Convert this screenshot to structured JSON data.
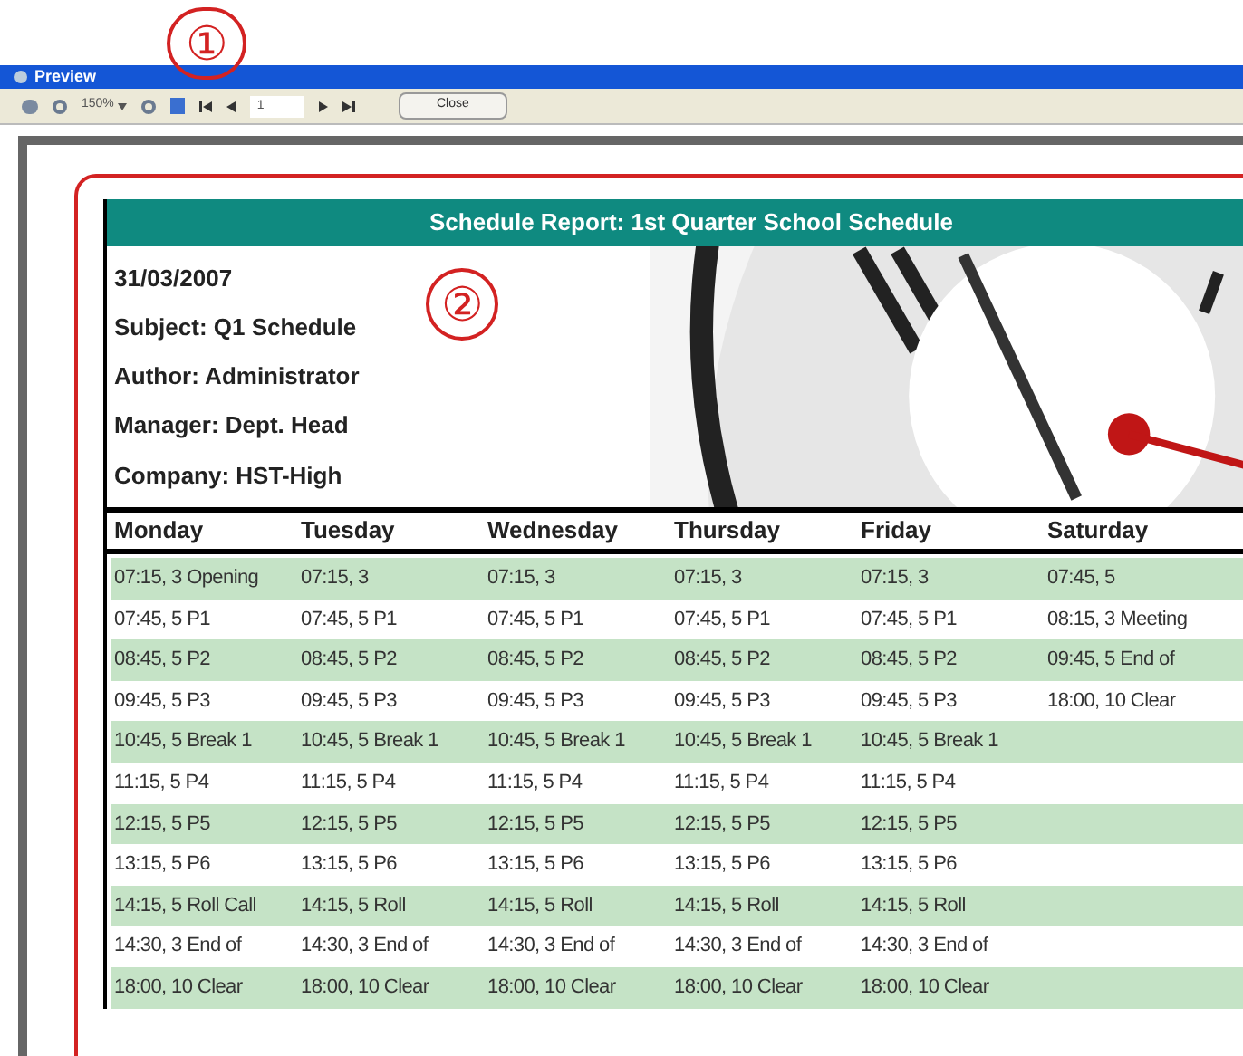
{
  "annotations": [
    "①",
    "②"
  ],
  "window": {
    "title": "Preview"
  },
  "toolbar": {
    "zoom": "150%",
    "page": "1",
    "close_button": "Close"
  },
  "report": {
    "title": "Schedule Report: 1st Quarter School Schedule",
    "info": [
      "31/03/2007",
      "Subject: Q1 Schedule",
      "Author: Administrator",
      "Manager: Dept. Head",
      "Company: HST-High"
    ],
    "columns": [
      "Monday",
      "Tuesday",
      "Wednesday",
      "Thursday",
      "Friday",
      "Saturday"
    ],
    "rows": [
      [
        "07:15, 3 Opening",
        "07:15, 3",
        "07:15, 3",
        "07:15, 3",
        "07:15, 3",
        "07:45, 5"
      ],
      [
        "07:45, 5 P1",
        "07:45, 5 P1",
        "07:45, 5 P1",
        "07:45, 5 P1",
        "07:45, 5 P1",
        "08:15, 3 Meeting"
      ],
      [
        "08:45, 5 P2",
        "08:45, 5 P2",
        "08:45, 5 P2",
        "08:45, 5 P2",
        "08:45, 5 P2",
        "09:45, 5 End of"
      ],
      [
        "09:45, 5 P3",
        "09:45, 5 P3",
        "09:45, 5 P3",
        "09:45, 5 P3",
        "09:45, 5 P3",
        "18:00, 10 Clear"
      ],
      [
        "10:45, 5 Break 1",
        "10:45, 5 Break 1",
        "10:45, 5 Break 1",
        "10:45, 5 Break 1",
        "10:45, 5 Break 1"
      ],
      [
        "11:15, 5 P4",
        "11:15, 5 P4",
        "11:15, 5 P4",
        "11:15, 5 P4",
        "11:15, 5 P4"
      ],
      [
        "12:15, 5 P5",
        "12:15, 5 P5",
        "12:15, 5 P5",
        "12:15, 5 P5",
        "12:15, 5 P5"
      ],
      [
        "13:15, 5 P6",
        "13:15, 5 P6",
        "13:15, 5 P6",
        "13:15, 5 P6",
        "13:15, 5 P6"
      ],
      [
        "14:15, 5 Roll Call",
        "14:15, 5 Roll",
        "14:15, 5 Roll",
        "14:15, 5 Roll",
        "14:15, 5 Roll"
      ],
      [
        "14:30, 3 End of",
        "14:30, 3 End of",
        "14:30, 3 End of",
        "14:30, 3 End of",
        "14:30, 3 End of"
      ],
      [
        "18:00, 10 Clear",
        "18:00, 10 Clear",
        "18:00, 10 Clear",
        "18:00, 10 Clear",
        "18:00, 10 Clear"
      ]
    ]
  }
}
